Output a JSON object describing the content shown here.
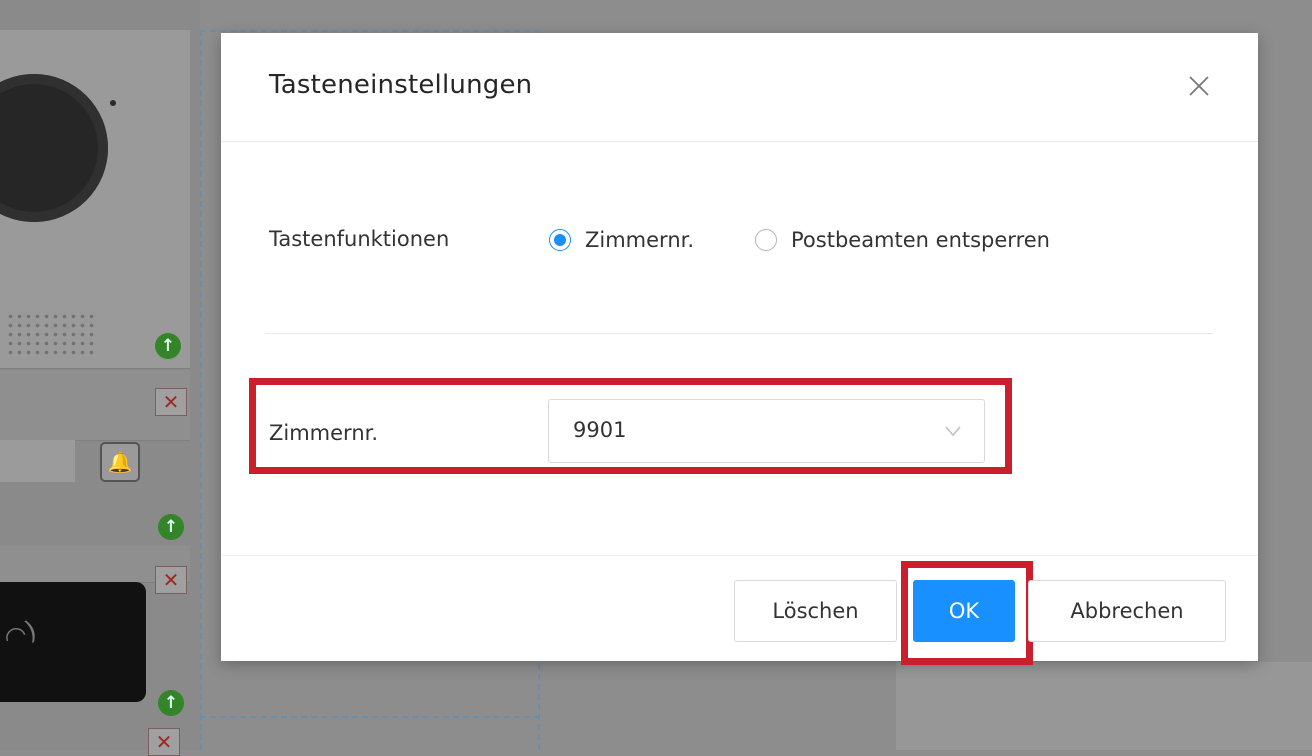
{
  "dialog": {
    "title": "Tasteneinstellungen",
    "close_icon": "close-icon",
    "key_function": {
      "label": "Tastenfunktionen",
      "options": [
        {
          "label": "Zimmernr.",
          "selected": true
        },
        {
          "label": "Postbeamten entsperren",
          "selected": false
        }
      ]
    },
    "room_number": {
      "label": "Zimmernr.",
      "value": "9901",
      "icon": "chevron-down-icon"
    },
    "buttons": {
      "delete": "Löschen",
      "ok": "OK",
      "cancel": "Abbrechen"
    }
  },
  "background": {
    "icons": [
      "camera",
      "speaker-grille",
      "bell-icon",
      "upload-icon",
      "remove-icon",
      "card-reader"
    ]
  },
  "colors": {
    "primary": "#1890ff",
    "highlight": "#cc1f2d",
    "upload_green": "#34842a",
    "remove_red": "#9c2b24"
  }
}
